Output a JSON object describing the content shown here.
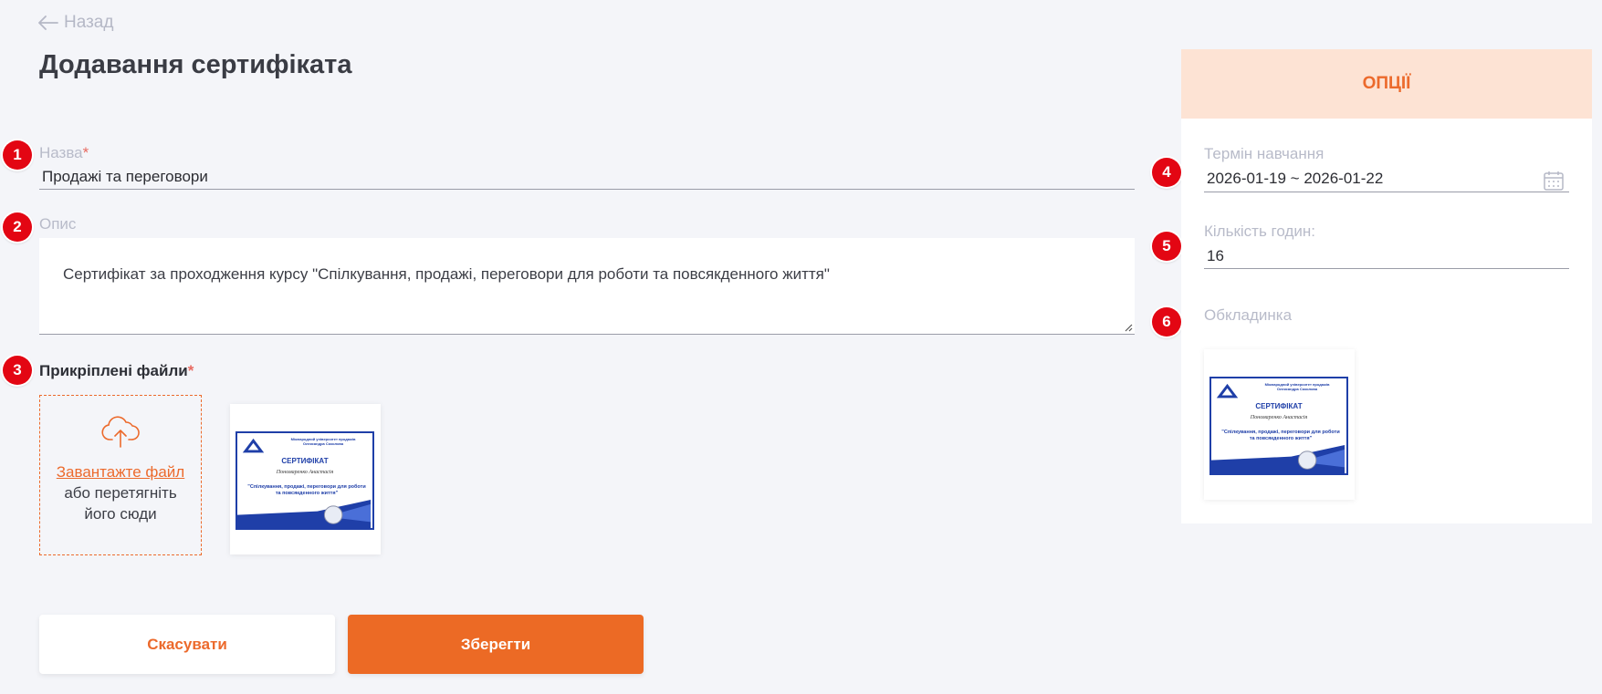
{
  "back_label": "Назад",
  "page_title": "Додавання сертифіката",
  "markers": [
    "1",
    "2",
    "3",
    "4",
    "5",
    "6"
  ],
  "name_field": {
    "label": "Назва",
    "required_mark": "*",
    "value": "Продажі та переговори"
  },
  "description_field": {
    "label": "Опис",
    "value": "Сертифікат за проходження курсу \"Спілкування, продажі, переговори для роботи та повсякденного життя\""
  },
  "files": {
    "label": "Прикріплені файли",
    "required_mark": "*",
    "upload_link": "Завантажте файл",
    "upload_hint_1": "або перетягніть",
    "upload_hint_2": "його сюди"
  },
  "certificate_preview": {
    "university": "Міжнародний університет продажів",
    "founder": "Олександра Соколова",
    "heading": "СЕРТИФІКАТ",
    "recipient": "Пономаренко Анастасія",
    "course": "\"Спілкування, продажі, переговори для роботи та повсякденного життя\""
  },
  "buttons": {
    "cancel": "Скасувати",
    "save": "Зберегти"
  },
  "options_panel": {
    "title": "ОПЦІЇ",
    "study_period_label": "Термін навчання",
    "study_period_value": "2026-01-19 ~ 2026-01-22",
    "hours_label": "Кількість годин:",
    "hours_value": "16",
    "cover_label": "Обкладинка"
  },
  "colors": {
    "accent": "#ec6a25",
    "marker": "#e30613",
    "panel_header_bg": "#fde3d4"
  }
}
